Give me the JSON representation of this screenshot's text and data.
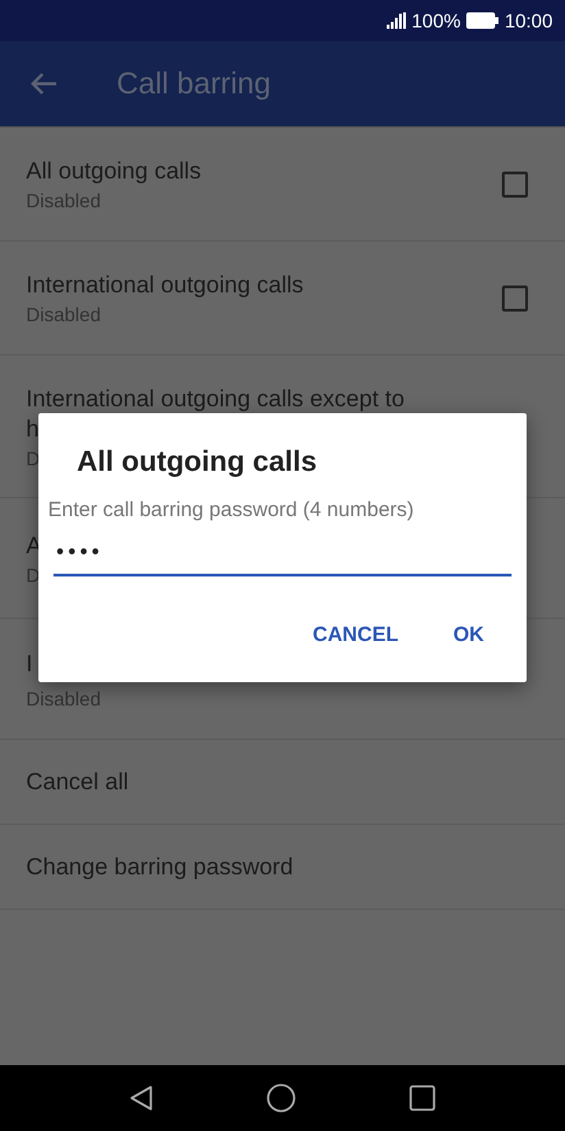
{
  "status_bar": {
    "battery": "100%",
    "time": "10:00"
  },
  "app_bar": {
    "title": "Call barring"
  },
  "items": [
    {
      "kind": "checkbox",
      "title_lines": [
        "All outgoing calls"
      ],
      "subtitle": "Disabled",
      "checked": false
    },
    {
      "kind": "checkbox",
      "title_lines": [
        "International outgoing calls"
      ],
      "subtitle": "Disabled",
      "checked": false
    },
    {
      "kind": "covered",
      "title_lines": [
        "International outgoing calls except to",
        "h"
      ],
      "subtitle": "D"
    },
    {
      "kind": "covered",
      "title_lines": [
        "A"
      ],
      "subtitle": "D"
    },
    {
      "kind": "covered",
      "title_lines": [
        "I"
      ],
      "subtitle": "Disabled"
    },
    {
      "kind": "action",
      "title_lines": [
        "Cancel all"
      ]
    },
    {
      "kind": "action",
      "title_lines": [
        "Change barring password"
      ]
    }
  ],
  "dialog": {
    "title": "All outgoing calls",
    "prompt": "Enter call barring password (4 numbers)",
    "value": "••••",
    "buttons": [
      "CANCEL",
      "OK"
    ]
  }
}
